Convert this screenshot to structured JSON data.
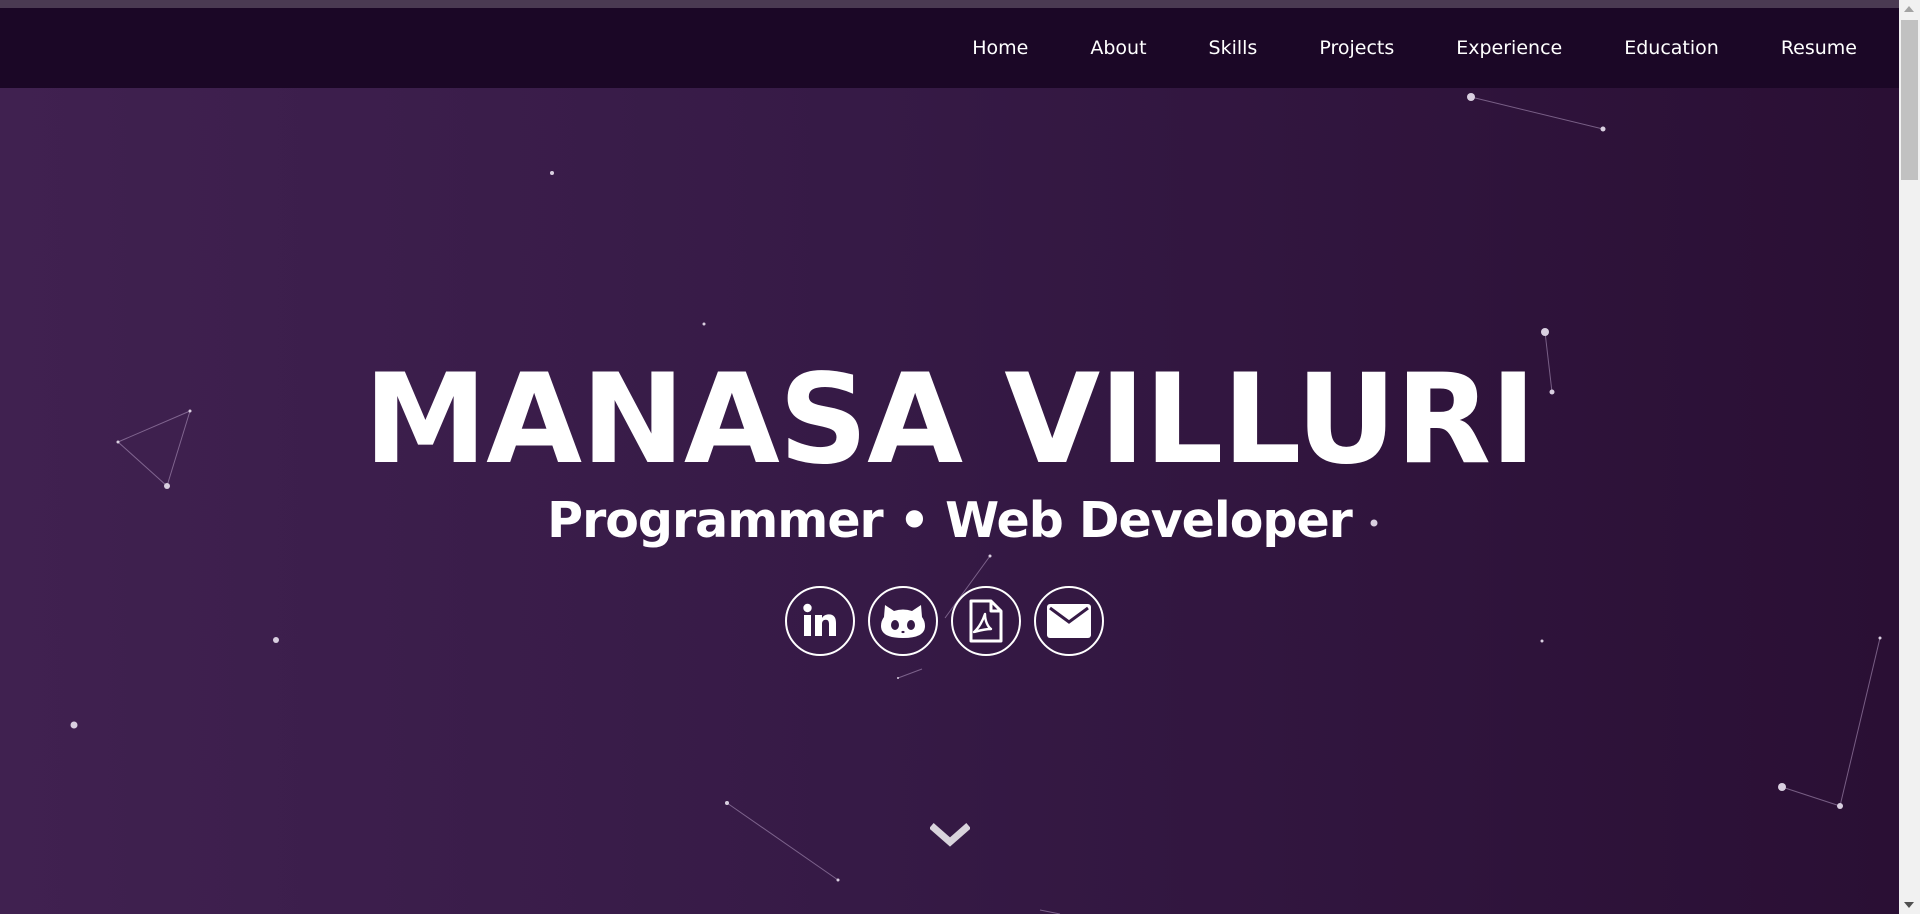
{
  "nav": {
    "items": [
      {
        "label": "Home"
      },
      {
        "label": "About"
      },
      {
        "label": "Skills"
      },
      {
        "label": "Projects"
      },
      {
        "label": "Experience"
      },
      {
        "label": "Education"
      },
      {
        "label": "Resume"
      }
    ]
  },
  "hero": {
    "title": "MANASA VILLURI",
    "subtitle": "Programmer • Web Developer"
  },
  "social": [
    {
      "icon": "linkedin-icon"
    },
    {
      "icon": "github-icon"
    },
    {
      "icon": "pdf-resume-icon"
    },
    {
      "icon": "email-icon"
    }
  ],
  "colors": {
    "navbar": "#1b0726",
    "hero_gradient_start": "#402150",
    "hero_gradient_end": "#2a0f34",
    "text": "#ffffff",
    "particle": "#d9cfe0"
  }
}
